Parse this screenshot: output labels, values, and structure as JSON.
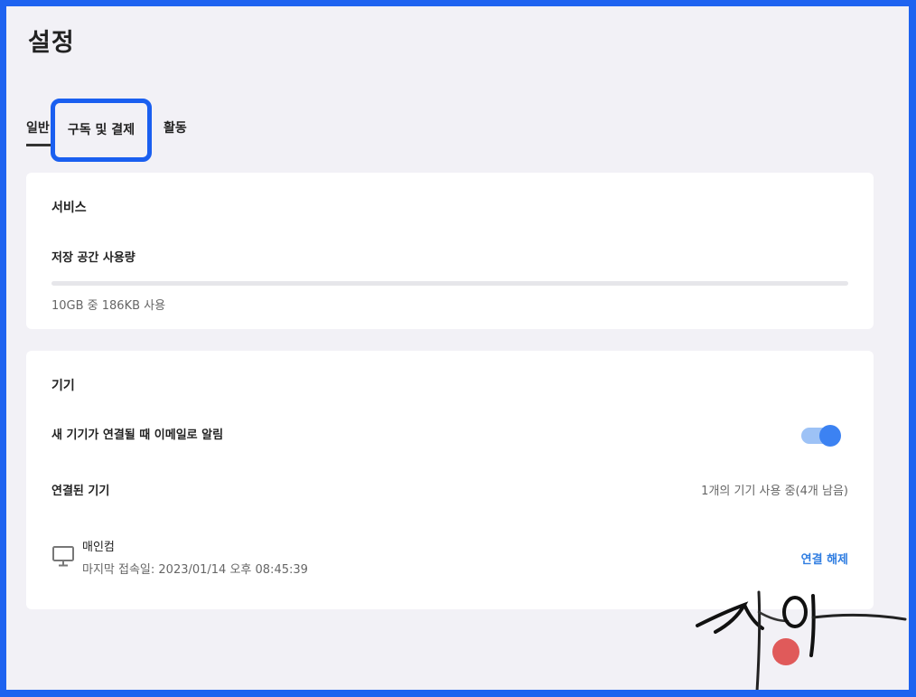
{
  "page": {
    "title": "설정"
  },
  "tabs": [
    {
      "label": "일반",
      "active": true
    },
    {
      "label": "구독 및 결제",
      "highlighted": true
    },
    {
      "label": "활동"
    }
  ],
  "service": {
    "title": "서비스",
    "storage_label": "저장 공간 사용량",
    "usage_fraction": 1.86e-05,
    "usage_text": "10GB 중 186KB 사용"
  },
  "devices": {
    "title": "기기",
    "notify_label": "새 기기가 연결될 때 이메일로 알림",
    "notify_enabled": true,
    "connected_label": "연결된 기기",
    "connected_count_text": "1개의 기기 사용 중(4개 남음)",
    "list": [
      {
        "name": "매인컴",
        "last_access": "마지막 접속일: 2023/01/14 오후 08:45:39",
        "action_label": "연결 해제",
        "icon": "monitor-icon"
      }
    ]
  },
  "colors": {
    "frame_border": "#1e63f0",
    "highlight": "#1a5ff0",
    "accent": "#3c82f2",
    "toggle_track": "#9dc2f6",
    "link": "#2f7de1",
    "seal": "#e05a5a"
  }
}
